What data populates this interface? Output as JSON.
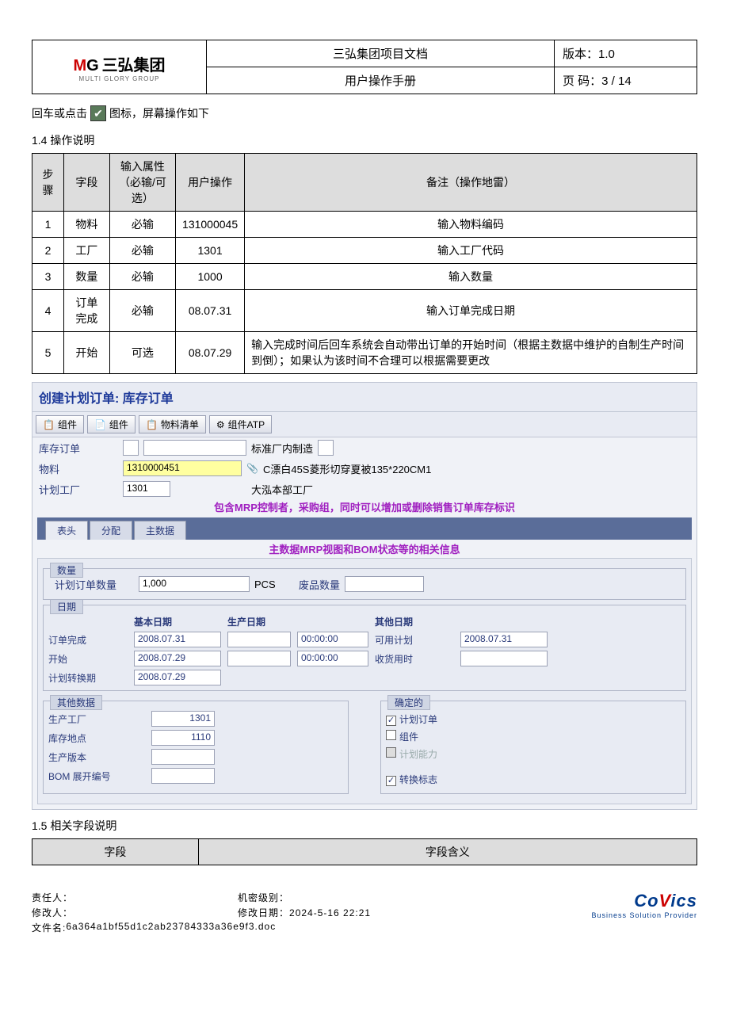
{
  "header": {
    "logo_main_prefix": "M",
    "logo_main_g": "G",
    "logo_cn": "三弘集团",
    "logo_en": "MULTI GLORY GROUP",
    "title": "三弘集团项目文档",
    "subtitle": "用户操作手册",
    "version_lbl": "版本：",
    "version": "1.0",
    "page_lbl": "页 码：",
    "page": "3  /  14"
  },
  "intro": {
    "pre": "回车或点击",
    "post": "图标，屏幕操作如下"
  },
  "sect14": "1.4 操作说明",
  "table14": {
    "headers": [
      "步骤",
      "字段",
      "输入属性\n（必输/可选）",
      "用户操作",
      "备注（操作地雷）"
    ],
    "rows": [
      [
        "1",
        "物料",
        "必输",
        "131000045",
        "输入物料编码"
      ],
      [
        "2",
        "工厂",
        "必输",
        "1301",
        "输入工厂代码"
      ],
      [
        "3",
        "数量",
        "必输",
        "1000",
        "输入数量"
      ],
      [
        "4",
        "订单完成",
        "必输",
        "08.07.31",
        "输入订单完成日期"
      ],
      [
        "5",
        "开始",
        "可选",
        "08.07.29",
        "输入完成时间后回车系统会自动带出订单的开始时间（根据主数据中维护的自制生产时间到倒）；如果认为该时间不合理可以根据需要更改"
      ]
    ]
  },
  "sap": {
    "title": "创建计划订单: 库存订单",
    "tb": [
      "组件",
      "组件",
      "物料清单",
      "组件ATP"
    ],
    "rows": {
      "stock_order": "库存订单",
      "std_mfg": "标准厂内制造",
      "material": "物料",
      "material_val": "1310000451",
      "material_desc": "C漂白45S菱形切穿夏被135*220CM1",
      "plant": "计划工厂",
      "plant_val": "1301",
      "plant_desc": "大泓本部工厂"
    },
    "anno1": "包含MRP控制者，采购组，同时可以增加或删除销售订单库存标识",
    "tabs": [
      "表头",
      "分配",
      "主数据"
    ],
    "anno2": "主数据MRP视图和BOM状态等的相关信息",
    "qty": {
      "legend": "数量",
      "plan_qty": "计划订单数量",
      "plan_val": "1,000",
      "uom": "PCS",
      "scrap": "废品数量"
    },
    "date": {
      "legend": "日期",
      "h1": "基本日期",
      "h2": "生产日期",
      "h3": "其他日期",
      "r1": "订单完成",
      "r1v": "2008.07.31",
      "r1t": "00:00:00",
      "r1b": "可用计划",
      "r1bv": "2008.07.31",
      "r2": "开始",
      "r2v": "2008.07.29",
      "r2t": "00:00:00",
      "r2b": "收货用时",
      "r3": "计划转换期",
      "r3v": "2008.07.29"
    },
    "other": {
      "legend": "其他数据",
      "plant": "生产工厂",
      "plant_v": "1301",
      "loc": "库存地点",
      "loc_v": "1110",
      "ver": "生产版本",
      "bom": "BOM 展开编号"
    },
    "fixed": {
      "legend": "确定的",
      "c1": "计划订单",
      "c2": "组件",
      "c3": "计划能力",
      "c4": "转换标志"
    }
  },
  "sect15": "1.5 相关字段说明",
  "table15": {
    "h1": "字段",
    "h2": "字段含义"
  },
  "footer": {
    "resp": "责任人：",
    "conf": "机密级别：",
    "mod": "修改人：",
    "moddate_lbl": "修改日期：",
    "moddate": "2024-5-16 22:21",
    "file_lbl": "文件名:",
    "file": "6a364a1bf55d1c2ab23784333a36e9f3.doc",
    "covics": "CoVics",
    "covics_sub": "Business Solution Provider"
  }
}
